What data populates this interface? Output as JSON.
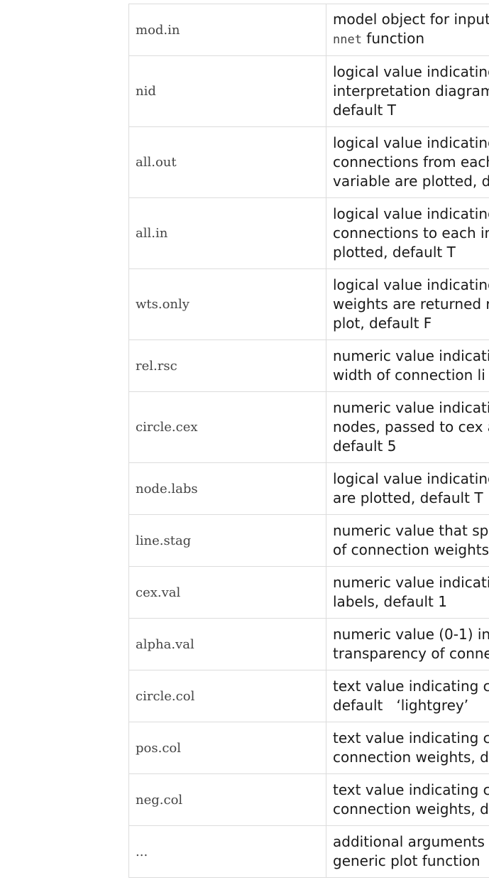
{
  "rows": [
    {
      "name": "mod.in",
      "lines": [
        "model object for input",
        "nnet function"
      ]
    },
    {
      "name": "nid",
      "lines": [
        "logical value indicating",
        "interpretation diagram",
        "default T"
      ]
    },
    {
      "name": "all.out",
      "lines": [
        "logical value indicating",
        "connections from each",
        "variable are plotted, d"
      ]
    },
    {
      "name": "all.in",
      "lines": [
        "logical value indicating",
        "connections to each in",
        "plotted, default T"
      ]
    },
    {
      "name": "wts.only",
      "lines": [
        "logical value indicating",
        "weights are returned r",
        "plot, default F"
      ]
    },
    {
      "name": "rel.rsc",
      "lines": [
        "numeric value indicati",
        "width of connection li"
      ]
    },
    {
      "name": "circle.cex",
      "lines": [
        "numeric value indicati",
        "nodes, passed to cex a",
        "default 5"
      ]
    },
    {
      "name": "node.labs",
      "lines": [
        "logical value indicating",
        "are plotted, default T"
      ]
    },
    {
      "name": "line.stag",
      "lines": [
        "numeric value that spe",
        "of connection weights"
      ]
    },
    {
      "name": "cex.val",
      "lines": [
        "numeric value indicati",
        "labels, default 1"
      ]
    },
    {
      "name": "alpha.val",
      "lines": [
        "numeric value (0-1) in",
        "transparency of conne"
      ]
    },
    {
      "name": "circle.col",
      "lines": [
        "text value indicating c",
        "default   ‘lightgrey’"
      ]
    },
    {
      "name": "pos.col",
      "lines": [
        "text value indicating c",
        "connection weights, d"
      ]
    },
    {
      "name": "neg.col",
      "lines": [
        "text value indicating c",
        "connection weights, d"
      ]
    },
    {
      "name": "...",
      "lines": [
        "additional arguments",
        "generic plot function"
      ]
    }
  ],
  "inline_code": {
    "nnet": "nnet",
    "mod_in_line2_suffix": " function"
  }
}
